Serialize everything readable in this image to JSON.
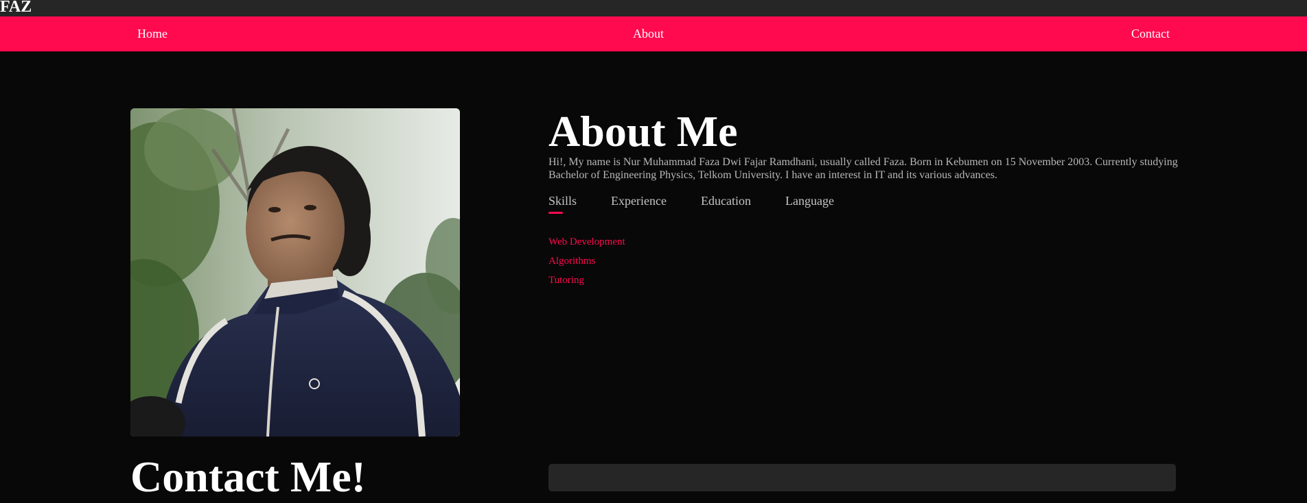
{
  "header": {
    "logo": "FAZ",
    "brand_color": "#ff0a4f"
  },
  "nav": {
    "items": [
      {
        "label": "Home"
      },
      {
        "label": "About"
      },
      {
        "label": "Contact"
      }
    ]
  },
  "about": {
    "title": "About Me",
    "description": "Hi!, My name is Nur Muhammad Faza Dwi Fajar Ramdhani, usually called Faza. Born in Kebumen on 15 November 2003. Currently studying Bachelor of Engineering Physics, Telkom University. I have an interest in IT and its various advances.",
    "photo_subject": "portrait-photo",
    "tabs": [
      {
        "label": "Skills",
        "active": true
      },
      {
        "label": "Experience",
        "active": false
      },
      {
        "label": "Education",
        "active": false
      },
      {
        "label": "Language",
        "active": false
      }
    ],
    "skills": [
      "Web Development",
      "Algorithms",
      "Tutoring"
    ]
  },
  "contact": {
    "title": "Contact Me!"
  }
}
